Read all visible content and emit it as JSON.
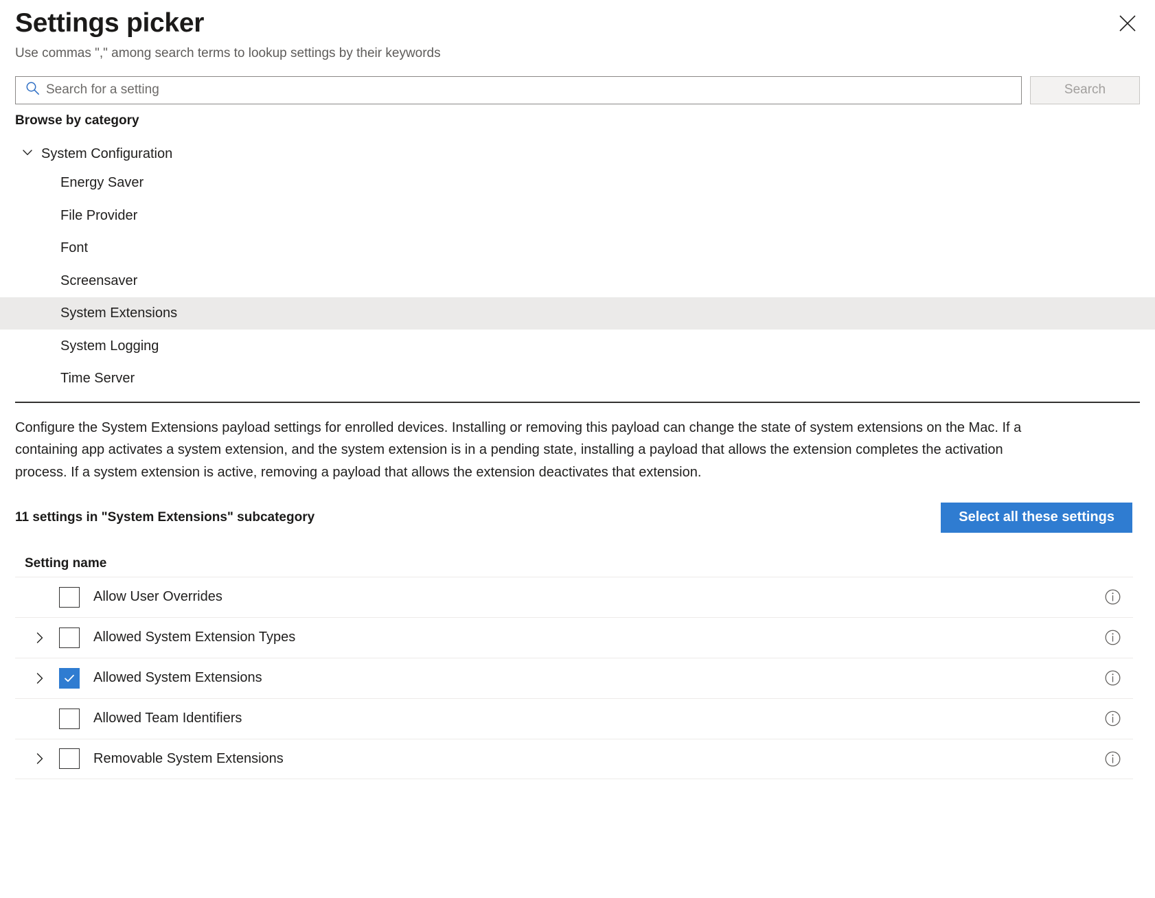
{
  "header": {
    "title": "Settings picker",
    "subtitle": "Use commas \",\" among search terms to lookup settings by their keywords",
    "close_icon": "close-icon"
  },
  "search": {
    "icon": "search-icon",
    "placeholder": "Search for a setting",
    "value": "",
    "button_label": "Search",
    "button_disabled": true
  },
  "browse": {
    "label": "Browse by category"
  },
  "category_tree": {
    "group": {
      "label": "System Configuration",
      "expanded": true,
      "chevron_icon": "chevron-down-icon"
    },
    "items": [
      {
        "label": "Energy Saver",
        "selected": false
      },
      {
        "label": "File Provider",
        "selected": false
      },
      {
        "label": "Font",
        "selected": false
      },
      {
        "label": "Screensaver",
        "selected": false
      },
      {
        "label": "System Extensions",
        "selected": true
      },
      {
        "label": "System Logging",
        "selected": false
      },
      {
        "label": "Time Server",
        "selected": false
      }
    ]
  },
  "description": "Configure the System Extensions payload settings for enrolled devices. Installing or removing this payload can change the state of system extensions on the Mac. If a containing app activates a system extension, and the system extension is in a pending state, installing a payload that allows the extension completes the activation process. If a system extension is active, removing a payload that allows the extension deactivates that extension.",
  "settings_summary": {
    "count_label": "11 settings in \"System Extensions\" subcategory",
    "select_all_label": "Select all these settings"
  },
  "table": {
    "columns": [
      "Setting name"
    ],
    "rows": [
      {
        "label": "Allow User Overrides",
        "checked": false,
        "expandable": false,
        "info_icon": "info-icon"
      },
      {
        "label": "Allowed System Extension Types",
        "checked": false,
        "expandable": true,
        "info_icon": "info-icon"
      },
      {
        "label": "Allowed System Extensions",
        "checked": true,
        "expandable": true,
        "info_icon": "info-icon"
      },
      {
        "label": "Allowed Team Identifiers",
        "checked": false,
        "expandable": false,
        "info_icon": "info-icon"
      },
      {
        "label": "Removable System Extensions",
        "checked": false,
        "expandable": true,
        "info_icon": "info-icon"
      }
    ]
  },
  "colors": {
    "accent": "#2f7cd1",
    "selected_row": "#ebeae9",
    "divider": "#323130",
    "row_divider": "#edebe9",
    "text": "#201f1e",
    "muted_text": "#5e5c5a"
  }
}
